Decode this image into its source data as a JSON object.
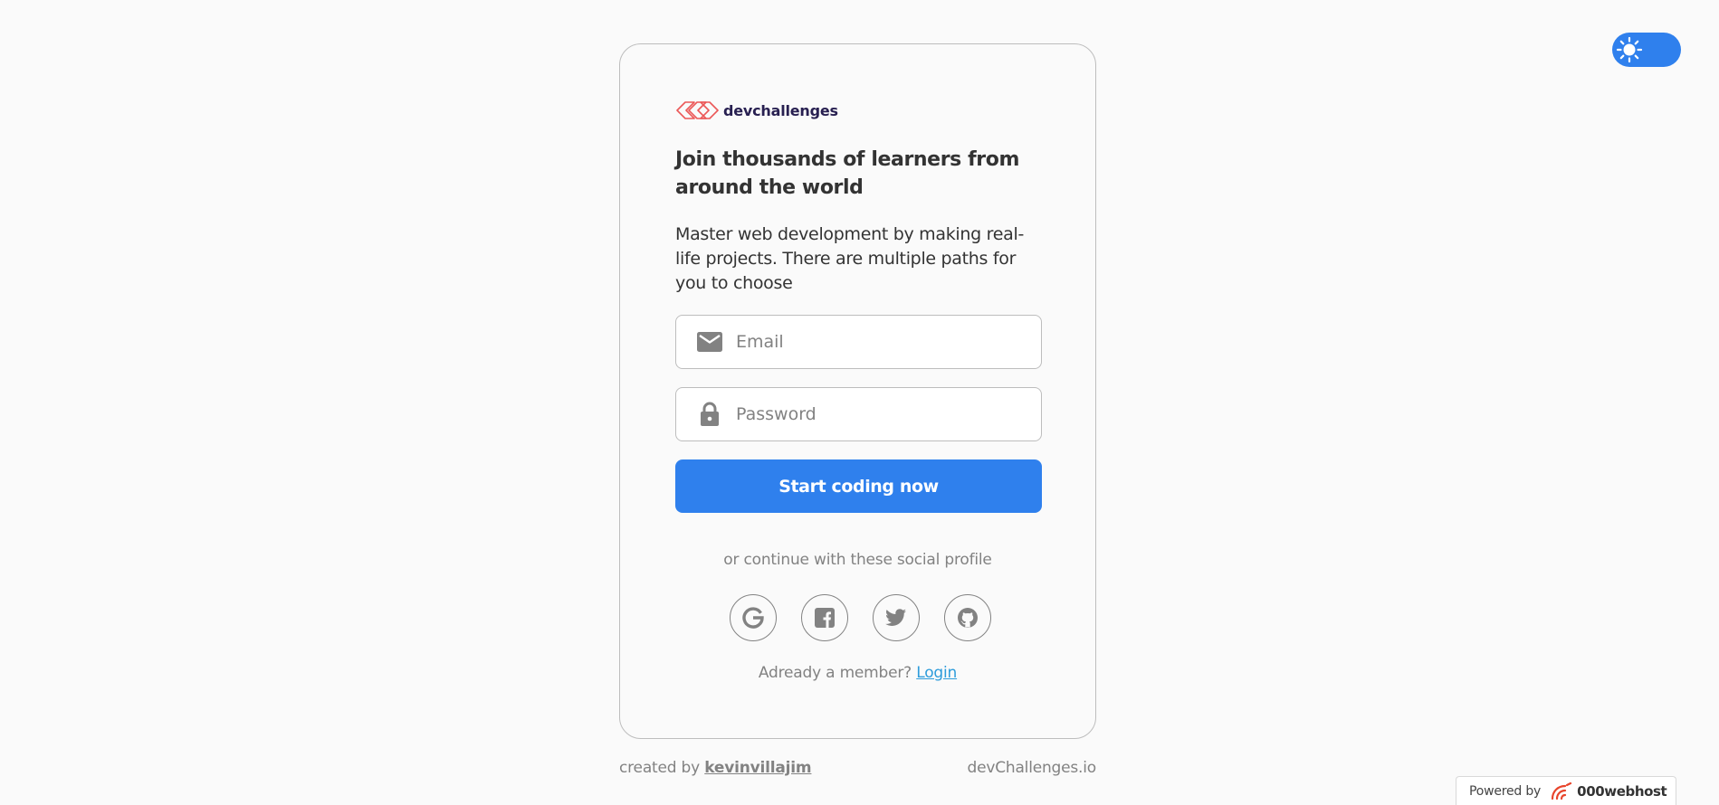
{
  "theme_toggle": {
    "icon": "sun-icon",
    "accent": "#2f80ed"
  },
  "card": {
    "brand_name": "devchallenges",
    "headline": "Join thousands of learners from around the world",
    "subtext": "Master web development by making real-life projects. There are multiple paths for you to choose",
    "email": {
      "icon": "mail-icon",
      "placeholder": "Email",
      "value": ""
    },
    "password": {
      "icon": "lock-icon",
      "placeholder": "Password",
      "value": ""
    },
    "cta_label": "Start coding now",
    "social_caption": "or continue with these social profile",
    "social": [
      {
        "name": "google",
        "icon": "google-icon"
      },
      {
        "name": "facebook",
        "icon": "facebook-icon"
      },
      {
        "name": "twitter",
        "icon": "twitter-icon"
      },
      {
        "name": "github",
        "icon": "github-icon"
      }
    ],
    "member_text": "Adready a member?",
    "login_label": "Login"
  },
  "footer": {
    "created_by": "created by",
    "author": "kevinvillajim",
    "site": "devChallenges.io"
  },
  "powered": {
    "label": "Powered by",
    "brand": "000webhost"
  },
  "colors": {
    "primary": "#2f80ed",
    "link": "#2d9cdb",
    "muted": "#828282",
    "border": "#bdbdbd",
    "background": "#fafafa",
    "brand_red": "#eb5757"
  }
}
